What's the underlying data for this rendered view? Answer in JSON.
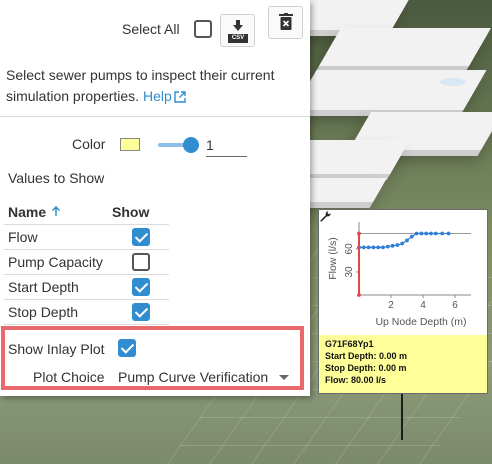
{
  "toolbar": {
    "select_all_label": "Select All",
    "select_all_checked": false,
    "csv_tag": "CSV",
    "csv_icon": "download-csv-icon",
    "delete_icon": "trash-icon"
  },
  "description": {
    "text": "Select sewer pumps to inspect their current simulation properties.",
    "help_link": "Help",
    "help_icon": "external-link-icon"
  },
  "color": {
    "label": "Color",
    "swatch": "#ffff99",
    "slider_value": 1,
    "input_value": "1"
  },
  "values": {
    "title": "Values to Show",
    "col_name": "Name",
    "col_show": "Show",
    "rows": [
      {
        "name": "Flow",
        "show": true
      },
      {
        "name": "Pump Capacity",
        "show": false
      },
      {
        "name": "Start Depth",
        "show": true
      },
      {
        "name": "Stop Depth",
        "show": true
      }
    ]
  },
  "inlay": {
    "show_label": "Show Inlay Plot",
    "show_checked": true,
    "choice_label": "Plot Choice",
    "choice_value": "Pump Curve Verification"
  },
  "popup": {
    "id": "G71F68Yp1",
    "start_depth": "Start Depth: 0.00 m",
    "stop_depth": "Stop Depth: 0.00 m",
    "flow": "Flow: 80.00 l/s",
    "background": "#ffff99",
    "icon": "wrench-icon"
  },
  "chart_data": {
    "type": "scatter",
    "xlabel": "Up Node Depth (m)",
    "ylabel": "Flow (l/s)",
    "xlim": [
      0,
      7
    ],
    "ylim": [
      0,
      95
    ],
    "xticks": [
      2,
      4,
      6
    ],
    "yticks": [
      30,
      60
    ],
    "series": [
      {
        "color": "#2f7fd8",
        "x": [
          0.0,
          0.3,
          0.6,
          0.9,
          1.2,
          1.5,
          1.8,
          2.1,
          2.4,
          2.7,
          3.0,
          3.3,
          3.6,
          3.9,
          4.2,
          4.5,
          4.8,
          5.2,
          5.6
        ],
        "y": [
          62,
          62,
          62,
          62,
          62,
          62,
          63,
          64,
          65,
          67,
          71,
          76,
          80,
          80,
          80,
          80,
          80,
          80,
          80
        ]
      },
      {
        "color": "#e04848",
        "x": [
          0,
          0
        ],
        "y": [
          0,
          80
        ]
      }
    ],
    "reference_line": {
      "y": 80
    }
  },
  "colors": {
    "accent": "#2f8dd0",
    "highlight": "#e8686b"
  }
}
